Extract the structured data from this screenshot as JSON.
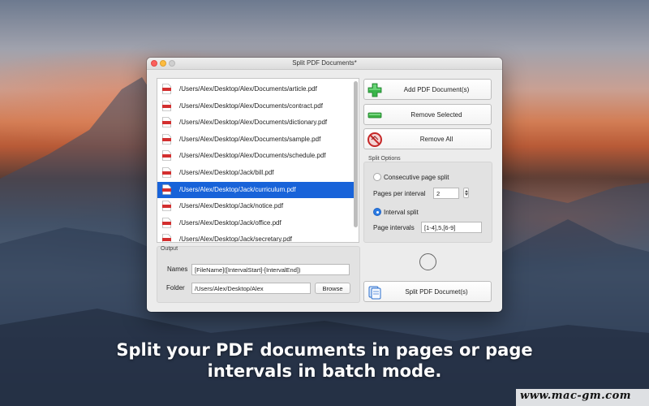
{
  "window": {
    "title": "Split PDF Documents*"
  },
  "files": [
    "/Users/Alex/Desktop/Alex/Documents/article.pdf",
    "/Users/Alex/Desktop/Alex/Documents/contract.pdf",
    "/Users/Alex/Desktop/Alex/Documents/dictionary.pdf",
    "/Users/Alex/Desktop/Alex/Documents/sample.pdf",
    "/Users/Alex/Desktop/Alex/Documents/schedule.pdf",
    "/Users/Alex/Desktop/Jack/bill.pdf",
    "/Users/Alex/Desktop/Jack/curriculum.pdf",
    "/Users/Alex/Desktop/Jack/notice.pdf",
    "/Users/Alex/Desktop/Jack/office.pdf",
    "/Users/Alex/Desktop/Jack/secretary.pdf"
  ],
  "selected_file": "/Users/Alex/Desktop/Jack/curriculum.pdf",
  "buttons": {
    "add": "Add PDF Document(s)",
    "remove_selected": "Remove Selected",
    "remove_all": "Remove All",
    "split": "Split PDF Documet(s)",
    "browse": "Browse"
  },
  "split_options": {
    "group_label": "Split Options",
    "consecutive_label": "Consecutive page split",
    "pages_per_interval_label": "Pages per interval",
    "pages_per_interval_value": "2",
    "interval_split_label": "Interval split",
    "page_intervals_label": "Page intervals",
    "page_intervals_value": "[1-4],5,[6-9]",
    "selected_mode": "Interval split"
  },
  "output": {
    "group_label": "Output",
    "names_label": "Names",
    "names_value": "[FileName]([IntervalStart]-[IntervalEnd])",
    "folder_label": "Folder",
    "folder_value": "/Users/Alex/Desktop/Alex"
  },
  "caption": {
    "line1": "Split your PDF documents in pages or page",
    "line2": "intervals in batch mode."
  },
  "watermark": "www.mac-gm.com",
  "colors": {
    "selection": "#1863d9",
    "add_icon": "#39b54a",
    "remove_icon": "#3cb043",
    "remove_all_icon": "#d32f2f",
    "radio_on": "#2a7ae2"
  },
  "icons": {
    "file": "pdf-file-icon",
    "add": "green-plus-icon",
    "remove": "green-minus-icon",
    "remove_all": "prohibited-icon",
    "split": "documents-icon"
  }
}
